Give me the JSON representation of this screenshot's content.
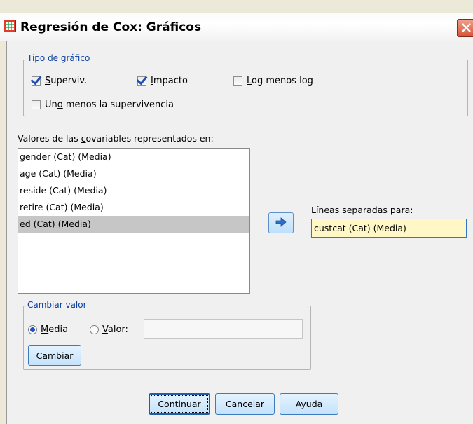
{
  "window": {
    "title": "Regresión de Cox: Gráficos"
  },
  "plot_type": {
    "legend": "Tipo de gráfico",
    "options": [
      {
        "pre": "",
        "ul": "S",
        "post": "uperviv.",
        "checked": true
      },
      {
        "pre": "",
        "ul": "I",
        "post": "mpacto",
        "checked": true
      },
      {
        "pre": "",
        "ul": "L",
        "post": "og menos log",
        "checked": false
      },
      {
        "pre": "Un",
        "ul": "o",
        "post": " menos la supervivencia",
        "checked": false
      }
    ]
  },
  "covariates": {
    "label_pre": "Valores de las ",
    "label_ul": "c",
    "label_post": "ovariables representados en:",
    "items": [
      "gender (Cat) (Media)",
      "age (Cat) (Media)",
      "reside (Cat) (Media)",
      "retire (Cat) (Media)",
      "ed (Cat) (Media)"
    ],
    "selected_index": 4
  },
  "separate_lines": {
    "label": "Líneas separadas para:",
    "value": "custcat (Cat) (Media)"
  },
  "change_value": {
    "legend": "Cambiar valor",
    "radio_mean": {
      "ul": "M",
      "post": "edia",
      "selected": true
    },
    "radio_value": {
      "ul": "V",
      "post": "alor:",
      "selected": false
    },
    "value_input": "",
    "change_button": "Cambiar"
  },
  "buttons": {
    "continue": "Continuar",
    "cancel": "Cancelar",
    "help": "Ayuda"
  },
  "icons": {
    "app": "spss-table-icon",
    "close": "close-icon",
    "move": "arrow-right-icon"
  }
}
